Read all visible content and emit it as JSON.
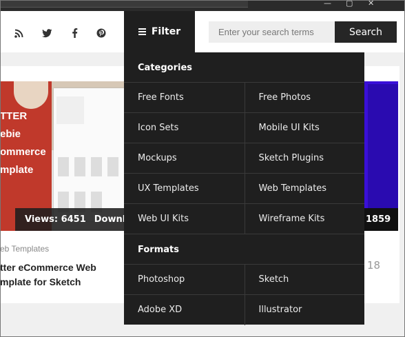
{
  "social": {
    "icons": [
      "rss-icon",
      "twitter-icon",
      "facebook-icon",
      "pinterest-icon"
    ]
  },
  "filter": {
    "label": "Filter",
    "icon": "hamburger-icon"
  },
  "search": {
    "placeholder": "Enter your search terms",
    "button_label": "Search"
  },
  "dropdown": {
    "categories_title": "Categories",
    "categories": [
      [
        "Free Fonts",
        "Free Photos"
      ],
      [
        "Icon Sets",
        "Mobile UI Kits"
      ],
      [
        "Mockups",
        "Sketch Plugins"
      ],
      [
        "UX Templates",
        "Web Templates"
      ],
      [
        "Web UI Kits",
        "Wireframe Kits"
      ]
    ],
    "formats_title": "Formats",
    "formats": [
      [
        "Photoshop",
        "Sketch"
      ],
      [
        "Adobe XD",
        "Illustrator"
      ]
    ]
  },
  "card": {
    "image_text": [
      "TTER",
      "ebie",
      "ommerce",
      "mplate"
    ],
    "views_label": "Views: 6451",
    "downloads_label": "Downlo",
    "category": "eb Templates",
    "title_line1": "tter eCommerce Web",
    "title_line2": "mplate for Sketch"
  },
  "right_card": {
    "views": "1859",
    "number": "18"
  },
  "colors": {
    "dark": "#1f1f1f",
    "accent_purple": "#3a10d8",
    "header_bg": "#ffffff"
  }
}
